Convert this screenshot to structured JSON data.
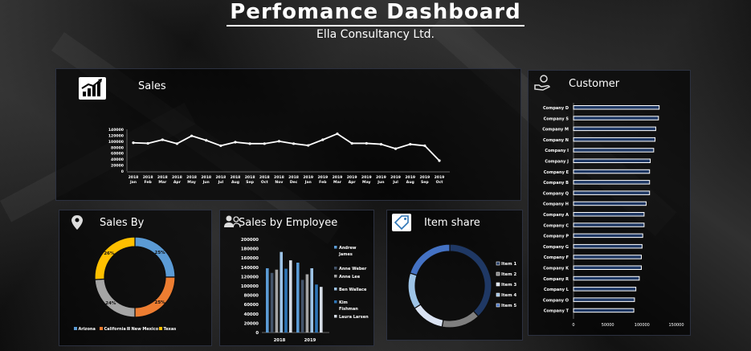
{
  "header": {
    "title": "Perfomance Dashboard",
    "subtitle": "Ella Consultancy Ltd."
  },
  "colors": {
    "panel_border": "#2c3140",
    "blue1": "#5b9bd5",
    "orange": "#ed7d31",
    "gray": "#a5a5a5",
    "yellow": "#ffc000",
    "navy": "#264478",
    "sky": "#9dc3e6"
  },
  "sales_panel": {
    "title": "Sales",
    "icon": "bar-chart-icon"
  },
  "customer_panel": {
    "title": "Customer",
    "icon": "hand-coin-icon"
  },
  "region_panel": {
    "title": "Sales By",
    "icon": "map-pin-icon"
  },
  "employee_panel": {
    "title": "Sales by Employee",
    "icon": "people-icon"
  },
  "item_panel": {
    "title": "Item share",
    "icon": "tag-icon"
  },
  "chart_data": [
    {
      "id": "sales",
      "type": "line",
      "title": "",
      "x": [
        [
          "2018",
          "Jan"
        ],
        [
          "2018",
          "Feb"
        ],
        [
          "2018",
          "Mar"
        ],
        [
          "2018",
          "Apr"
        ],
        [
          "2018",
          "May"
        ],
        [
          "2018",
          "Jun"
        ],
        [
          "2018",
          "Jul"
        ],
        [
          "2018",
          "Aug"
        ],
        [
          "2018",
          "Sep"
        ],
        [
          "2018",
          "Oct"
        ],
        [
          "2018",
          "Nov"
        ],
        [
          "2018",
          "Dec"
        ],
        [
          "2019",
          "Jan"
        ],
        [
          "2019",
          "Feb"
        ],
        [
          "2019",
          "Mar"
        ],
        [
          "2019",
          "Apr"
        ],
        [
          "2019",
          "May"
        ],
        [
          "2019",
          "Jun"
        ],
        [
          "2019",
          "Jul"
        ],
        [
          "2019",
          "Aug"
        ],
        [
          "2019",
          "Sep"
        ],
        [
          "2019",
          "Oct"
        ]
      ],
      "values": [
        95000,
        93000,
        105000,
        92000,
        118000,
        103000,
        85000,
        97000,
        92000,
        92000,
        100000,
        92000,
        86000,
        105000,
        125000,
        93000,
        93000,
        90000,
        75000,
        90000,
        85000,
        35000
      ],
      "ylim": [
        0,
        140000
      ],
      "yticks": [
        "0",
        "20000",
        "40000",
        "60000",
        "80000",
        "100000",
        "120000",
        "140000"
      ],
      "color": "#ffffff"
    },
    {
      "id": "customer",
      "type": "bar",
      "orientation": "horizontal",
      "categories": [
        "Company D",
        "Company S",
        "Company M",
        "Company N",
        "Company I",
        "Company J",
        "Company E",
        "Company B",
        "Company Q",
        "Company H",
        "Company A",
        "Company C",
        "Company P",
        "Company G",
        "Company F",
        "Company K",
        "Company R",
        "Company L",
        "Company O",
        "Company T"
      ],
      "values": [
        125000,
        124000,
        120000,
        119000,
        117000,
        112000,
        111000,
        111000,
        111000,
        106000,
        103000,
        103000,
        101000,
        100000,
        99000,
        99000,
        96000,
        91000,
        89000,
        88000
      ],
      "xlim": [
        0,
        150000
      ],
      "xticks": [
        "0",
        "50000",
        "100000",
        "150000"
      ],
      "color": "#1f3864"
    },
    {
      "id": "region",
      "type": "pie",
      "donut": true,
      "labels": [
        "Arizona",
        "California",
        "New Mexico",
        "Texas"
      ],
      "values": [
        25,
        25,
        24,
        26
      ],
      "data_labels": [
        "25%",
        "25%",
        "24%",
        "26%"
      ],
      "colors": [
        "#5b9bd5",
        "#ed7d31",
        "#a5a5a5",
        "#ffc000"
      ],
      "legend": "bottom"
    },
    {
      "id": "employee",
      "type": "bar",
      "categories": [
        "2018",
        "2019"
      ],
      "series": [
        {
          "name": "Andrew James",
          "values": [
            138000,
            150000
          ],
          "color": "#5b9bd5"
        },
        {
          "name": "Anne Weber",
          "values": [
            128000,
            113000
          ],
          "color": "#44546a"
        },
        {
          "name": "Anne Lee",
          "values": [
            135000,
            125000
          ],
          "color": "#a5a5a5"
        },
        {
          "name": "Ben Wallace",
          "values": [
            173000,
            138000
          ],
          "color": "#9dc3e6"
        },
        {
          "name": "Kim Fishman",
          "values": [
            137000,
            103000
          ],
          "color": "#2e75b6"
        },
        {
          "name": "Laura Larsen",
          "values": [
            155000,
            98000
          ],
          "color": "#d6dce5"
        }
      ],
      "legend_labels": [
        [
          "Andrew",
          "James"
        ],
        [
          "Anne Weber"
        ],
        [
          "Anne Lee"
        ],
        [
          "Ben Wallace"
        ],
        [
          "Kim",
          "Fishman"
        ],
        [
          "Laura Larsen"
        ]
      ],
      "ylim": [
        0,
        200000
      ],
      "yticks": [
        "0",
        "20000",
        "40000",
        "60000",
        "80000",
        "100000",
        "120000",
        "140000",
        "160000",
        "180000",
        "200000"
      ],
      "legend": "right"
    },
    {
      "id": "item",
      "type": "pie",
      "donut": true,
      "labels": [
        "Item 1",
        "Item 2",
        "Item 3",
        "Item 4",
        "Item 5"
      ],
      "values": [
        38,
        15,
        13,
        14,
        20
      ],
      "colors": [
        "#1f3864",
        "#7f7f7f",
        "#dae3f3",
        "#9dc3e6",
        "#4472c4"
      ],
      "legend": "right"
    }
  ]
}
